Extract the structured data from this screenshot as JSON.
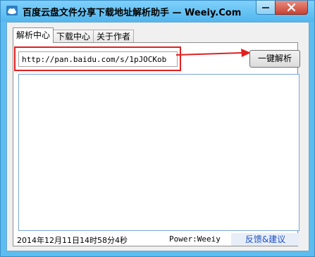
{
  "window": {
    "title": "百度云盘文件分享下载地址解析助手 — Weeiy.Com",
    "minimize_glyph": "—",
    "close_glyph": "✕"
  },
  "tabs": [
    {
      "label": "解析中心",
      "active": true
    },
    {
      "label": "下载中心",
      "active": false
    },
    {
      "label": "关于作者",
      "active": false
    }
  ],
  "parser": {
    "url_value": "http://pan.baidu.com/s/1pJOCKob",
    "parse_button": "一键解析",
    "result_text": ""
  },
  "status": {
    "time": "2014年12月11日14时58分4秒",
    "power": "Power:Weeiy",
    "feedback": "反馈&建议"
  },
  "colors": {
    "titlebar": "#5dbcf0",
    "highlight": "#e02020",
    "link": "#1c4fc3"
  }
}
